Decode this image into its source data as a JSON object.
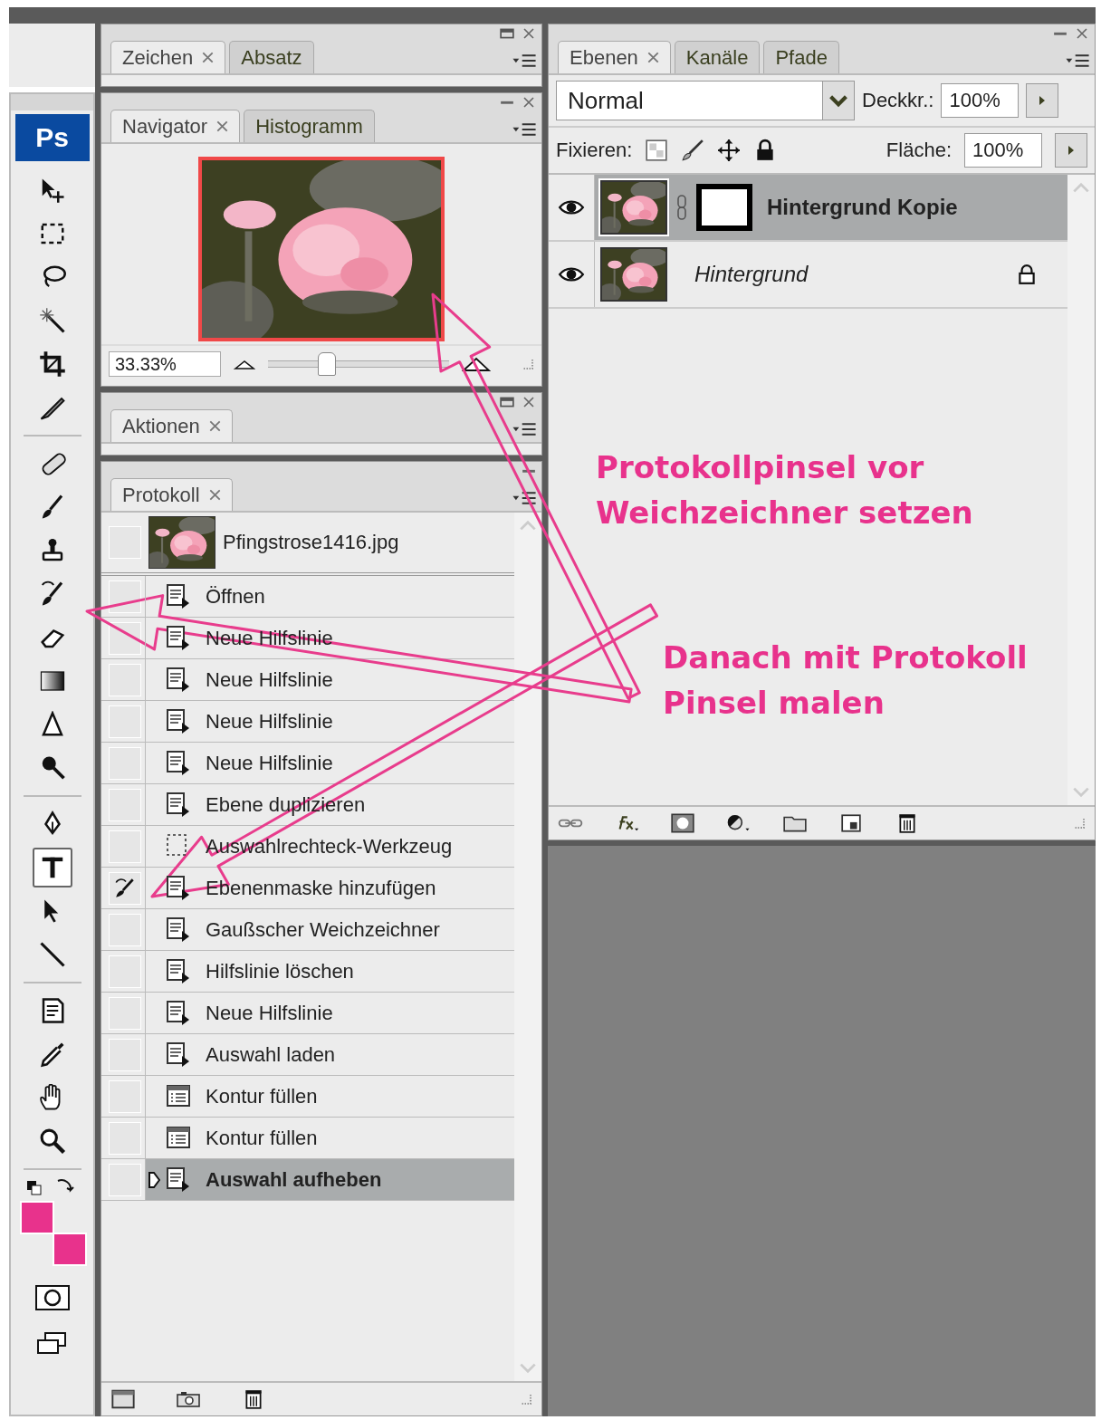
{
  "toolbox": {
    "logo": "Ps",
    "groups": [
      [
        {
          "kind": "move",
          "selected": false
        },
        {
          "kind": "marquee",
          "selected": false
        },
        {
          "kind": "lasso",
          "selected": false
        },
        {
          "kind": "wand",
          "selected": false
        },
        {
          "kind": "crop",
          "selected": false
        },
        {
          "kind": "slice",
          "selected": false
        }
      ],
      [
        {
          "kind": "heal",
          "selected": false
        },
        {
          "kind": "brush",
          "selected": false
        },
        {
          "kind": "stamp",
          "selected": false
        },
        {
          "kind": "history_brush",
          "selected": false
        },
        {
          "kind": "eraser",
          "selected": false
        },
        {
          "kind": "gradient",
          "selected": false
        },
        {
          "kind": "blur",
          "selected": false
        },
        {
          "kind": "dodge",
          "selected": false
        }
      ],
      [
        {
          "kind": "pen",
          "selected": false
        },
        {
          "kind": "type",
          "selected": true
        },
        {
          "kind": "path_select",
          "selected": false
        },
        {
          "kind": "line",
          "selected": false
        }
      ],
      [
        {
          "kind": "notes",
          "selected": false
        },
        {
          "kind": "eyedropper",
          "selected": false
        },
        {
          "kind": "hand",
          "selected": false
        },
        {
          "kind": "zoom",
          "selected": false
        }
      ]
    ]
  },
  "character_panel": {
    "tabs": [
      {
        "label": "Zeichen",
        "selected": true
      },
      {
        "label": "Absatz",
        "selected": false
      }
    ]
  },
  "navigator_panel": {
    "tabs": [
      {
        "label": "Navigator",
        "selected": true
      },
      {
        "label": "Histogramm",
        "selected": false
      }
    ],
    "zoom": "33.33%",
    "zoom_slider": {
      "level": 0.32
    }
  },
  "actions_panel": {
    "tabs": [
      {
        "label": "Aktionen",
        "selected": true
      }
    ]
  },
  "history_panel": {
    "tabs": [
      {
        "label": "Protokoll",
        "selected": true
      }
    ],
    "snapshot": {
      "name": "Pfingstrose1416.jpg",
      "brush_source": false
    },
    "steps": [
      {
        "label": "Öffnen",
        "kind": "step",
        "brush_source": false,
        "selected": false
      },
      {
        "label": "Neue Hilfslinie",
        "kind": "step",
        "brush_source": false,
        "selected": false
      },
      {
        "label": "Neue Hilfslinie",
        "kind": "step",
        "brush_source": false,
        "selected": false
      },
      {
        "label": "Neue Hilfslinie",
        "kind": "step",
        "brush_source": false,
        "selected": false
      },
      {
        "label": "Neue Hilfslinie",
        "kind": "step",
        "brush_source": false,
        "selected": false
      },
      {
        "label": "Ebene duplizieren",
        "kind": "step",
        "brush_source": false,
        "selected": false
      },
      {
        "label": "Auswahlrechteck-Werkzeug",
        "kind": "marquee",
        "brush_source": false,
        "selected": false
      },
      {
        "label": "Ebenenmaske hinzufügen",
        "kind": "step",
        "brush_source": true,
        "selected": false
      },
      {
        "label": "Gaußscher Weichzeichner",
        "kind": "step",
        "brush_source": false,
        "selected": false
      },
      {
        "label": "Hilfslinie löschen",
        "kind": "step",
        "brush_source": false,
        "selected": false
      },
      {
        "label": "Neue Hilfslinie",
        "kind": "step",
        "brush_source": false,
        "selected": false
      },
      {
        "label": "Auswahl laden",
        "kind": "step",
        "brush_source": false,
        "selected": false
      },
      {
        "label": "Kontur füllen",
        "kind": "fill",
        "brush_source": false,
        "selected": false
      },
      {
        "label": "Kontur füllen",
        "kind": "fill",
        "brush_source": false,
        "selected": false
      },
      {
        "label": "Auswahl aufheben",
        "kind": "step",
        "brush_source": false,
        "selected": true
      }
    ]
  },
  "layers_panel": {
    "tabs": [
      {
        "label": "Ebenen",
        "selected": true
      },
      {
        "label": "Kanäle",
        "selected": false
      },
      {
        "label": "Pfade",
        "selected": false
      }
    ],
    "blend_mode": "Normal",
    "opacity_label": "Deckkr.:",
    "opacity": "100%",
    "lock_label": "Fixieren:",
    "fill_label": "Fläche:",
    "fill": "100%",
    "layers": [
      {
        "name": "Hintergrund Kopie",
        "kind": "layer",
        "visible": true,
        "mask": true,
        "locked": false,
        "selected": true
      },
      {
        "name": "Hintergrund",
        "kind": "background",
        "visible": true,
        "mask": false,
        "locked": true,
        "selected": false
      }
    ]
  },
  "annotations": [
    "Protokollpinsel vor Weichzeichner setzen",
    "Danach mit Protokoll Pinsel malen"
  ]
}
